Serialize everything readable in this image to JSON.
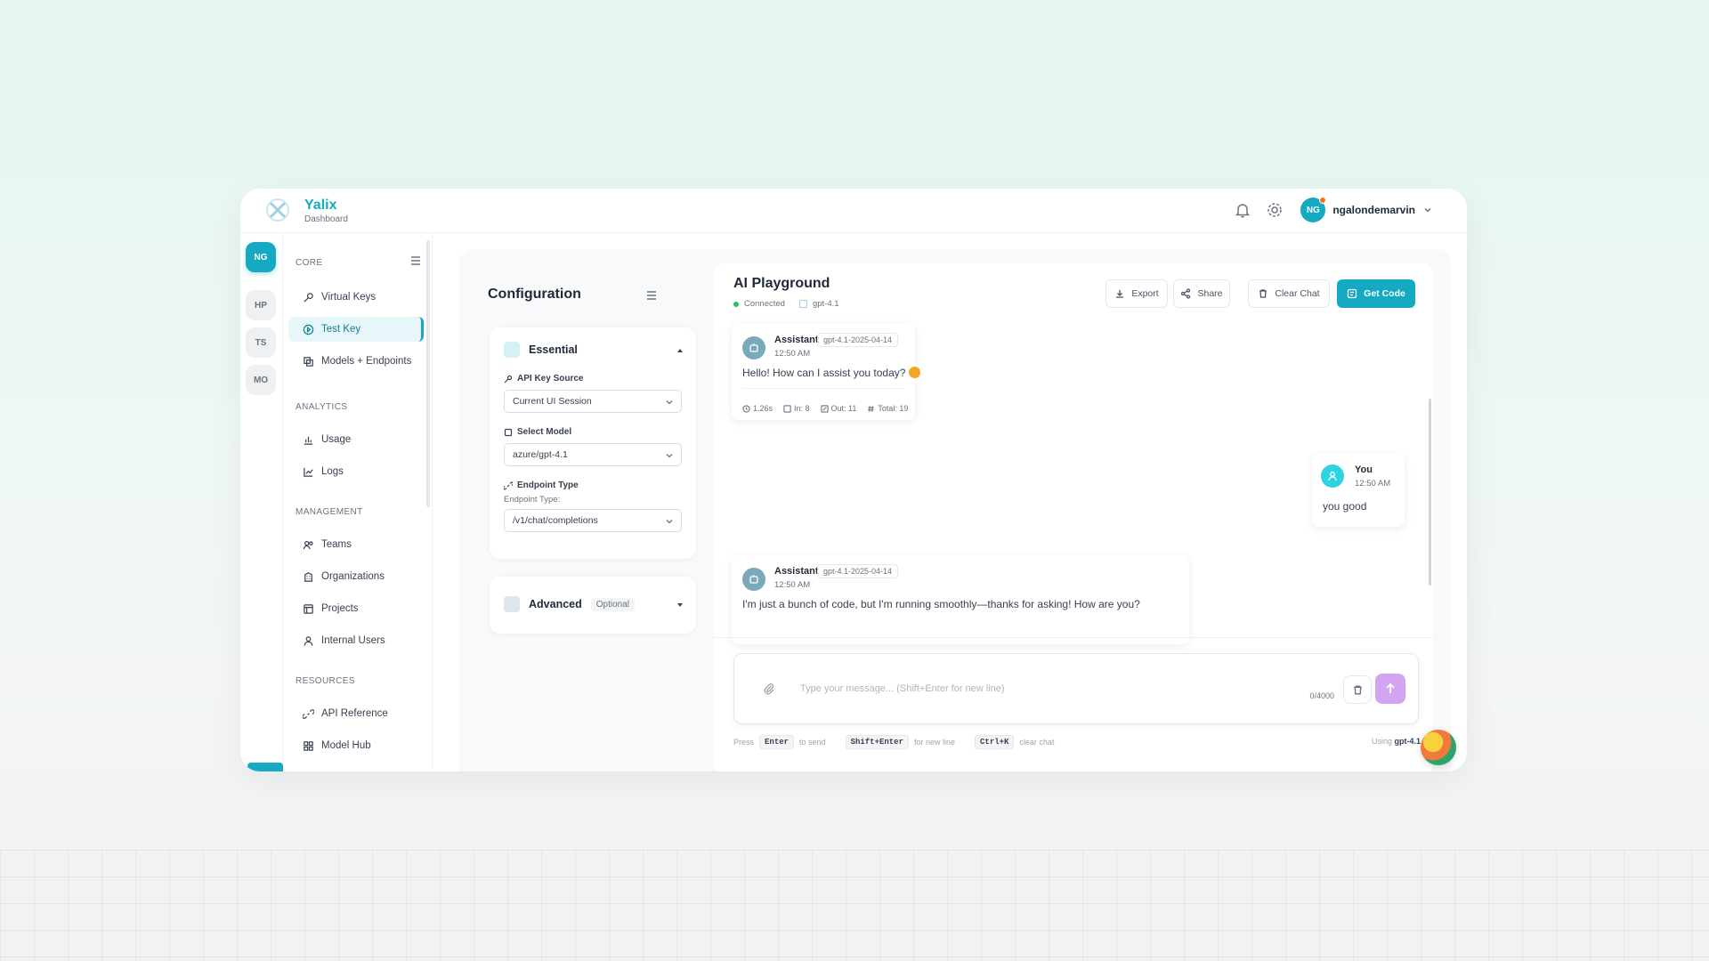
{
  "app": {
    "name": "Yalix",
    "subtitle": "Dashboard"
  },
  "header": {
    "user_initials": "NG",
    "user_name": "ngalondemarvin"
  },
  "rail": [
    "NG",
    "HP",
    "TS",
    "MO"
  ],
  "sidebar": {
    "sections": [
      {
        "title": "CORE",
        "items": [
          "Virtual Keys",
          "Test Key",
          "Models + Endpoints"
        ]
      },
      {
        "title": "ANALYTICS",
        "items": [
          "Usage",
          "Logs"
        ]
      },
      {
        "title": "MANAGEMENT",
        "items": [
          "Teams",
          "Organizations",
          "Projects",
          "Internal Users"
        ]
      },
      {
        "title": "RESOURCES",
        "items": [
          "API Reference",
          "Model Hub"
        ]
      }
    ],
    "active_item": "Test Key"
  },
  "config": {
    "title": "Configuration",
    "essential": {
      "title": "Essential",
      "api_key_label": "API Key Source",
      "api_key_value": "Current UI Session",
      "model_label": "Select Model",
      "model_value": "azure/gpt-4.1",
      "endpoint_label": "Endpoint Type",
      "endpoint_sub": "Endpoint Type:",
      "endpoint_value": "/v1/chat/completions"
    },
    "advanced": {
      "title": "Advanced",
      "badge": "Optional"
    }
  },
  "chat": {
    "title": "AI Playground",
    "status": "Connected",
    "model": "gpt-4.1",
    "buttons": {
      "export": "Export",
      "share": "Share",
      "clear": "Clear Chat",
      "get_code": "Get Code"
    },
    "messages": [
      {
        "role": "Assistant",
        "model": "gpt-4.1-2025-04-14",
        "time": "12:50 AM",
        "text": "Hello! How can I assist you today?",
        "stats": {
          "latency": "1.26s",
          "in": "In: 8",
          "out": "Out: 11",
          "total": "Total: 19"
        }
      },
      {
        "role": "You",
        "time": "12:50 AM",
        "text": "you good"
      },
      {
        "role": "Assistant",
        "model": "gpt-4.1-2025-04-14",
        "time": "12:50 AM",
        "text": "I'm just a bunch of code, but I'm running smoothly—thanks for asking! How are you?"
      }
    ],
    "input_placeholder": "Type your message... (Shift+Enter for new line)",
    "counter": "0/4000",
    "hints": {
      "press": "Press",
      "enter_key": "Enter",
      "to_send": "to send",
      "shift_enter_key": "Shift+Enter",
      "new_line": "for new line",
      "ctrl_k_key": "Ctrl+K",
      "clear_chat": "clear chat"
    },
    "using_label": "Using",
    "using_model": "gpt-4.1"
  },
  "colors": {
    "accent": "#15a9c2",
    "send": "#d3a4f2",
    "connected": "#22c55e"
  }
}
